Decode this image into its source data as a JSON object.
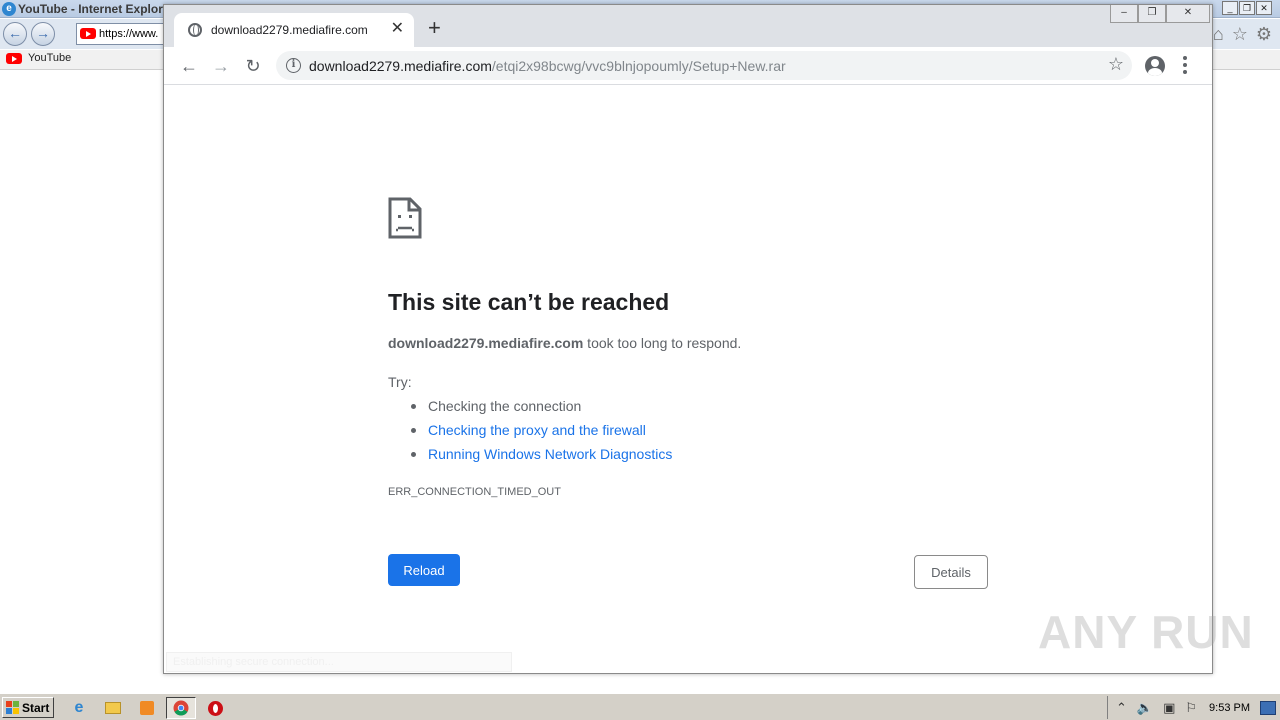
{
  "ie_window": {
    "title": "YouTube - Internet Explorer",
    "address": "https://www.",
    "favorites_item": "YouTube"
  },
  "chrome": {
    "tab_title": "download2279.mediafire.com",
    "url_host": "download2279.mediafire.com",
    "url_path": "/etqi2x98bcwg/vvc9blnjopoumly/Setup+New.rar"
  },
  "error_page": {
    "title": "This site can’t be reached",
    "host": "download2279.mediafire.com",
    "message_suffix": " took too long to respond.",
    "try_label": "Try:",
    "suggestions": [
      "Checking the connection",
      "Checking the proxy and the firewall",
      "Running Windows Network Diagnostics"
    ],
    "error_code": "ERR_CONNECTION_TIMED_OUT",
    "reload_label": "Reload",
    "details_label": "Details",
    "status_text": "Establishing secure connection..."
  },
  "watermark": "ANY RUN",
  "taskbar": {
    "start_label": "Start",
    "clock": "9:53 PM"
  },
  "colors": {
    "accent_blue": "#1a73e8",
    "text_gray": "#5f6368",
    "title_dark": "#202124"
  }
}
